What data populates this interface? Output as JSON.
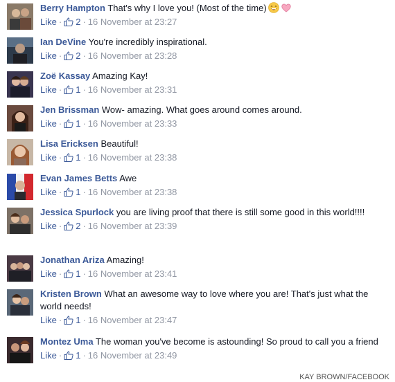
{
  "comments": [
    {
      "name": "Berry Hampton",
      "text": "That's why I love you! (Most of the time)",
      "emojis": [
        "laughing-face-icon",
        "pink-heart-icon"
      ],
      "like_label": "Like",
      "likes": "2",
      "timestamp": "16 November at 23:27"
    },
    {
      "name": "Ian DeVine",
      "text": "You're incredibly inspirational.",
      "like_label": "Like",
      "likes": "2",
      "timestamp": "16 November at 23:28"
    },
    {
      "name": "Zoë Kassay",
      "text": "Amazing Kay!",
      "like_label": "Like",
      "likes": "1",
      "timestamp": "16 November at 23:31"
    },
    {
      "name": "Jen Brissman",
      "text": "Wow- amazing. What goes around comes around.",
      "like_label": "Like",
      "likes": "1",
      "timestamp": "16 November at 23:33"
    },
    {
      "name": "Lisa Ericksen",
      "text": "Beautiful!",
      "like_label": "Like",
      "likes": "1",
      "timestamp": "16 November at 23:38"
    },
    {
      "name": "Evan James Betts",
      "text": "Awe",
      "like_label": "Like",
      "likes": "1",
      "timestamp": "16 November at 23:38"
    },
    {
      "name": "Jessica Spurlock",
      "text": "you are living proof that there is still some good in this world!!!!",
      "like_label": "Like",
      "likes": "2",
      "timestamp": "16 November at 23:39"
    },
    {
      "name": "Jonathan Ariza",
      "text": "Amazing!",
      "like_label": "Like",
      "likes": "1",
      "timestamp": "16 November at 23:41"
    },
    {
      "name": "Kristen Brown",
      "text": "What an awesome way to love where you are! That's just what the world needs!",
      "like_label": "Like",
      "likes": "1",
      "timestamp": "16 November at 23:47"
    },
    {
      "name": "Montez Uma",
      "text": "The woman you've become is astounding! So proud to call you a friend",
      "like_label": "Like",
      "likes": "1",
      "timestamp": "16 November at 23:49"
    }
  ],
  "separator": "·",
  "credit": "KAY BROWN/FACEBOOK",
  "colors": {
    "name_link": "#3b5998",
    "meta_text": "#9197a3",
    "body_text": "#141823"
  }
}
